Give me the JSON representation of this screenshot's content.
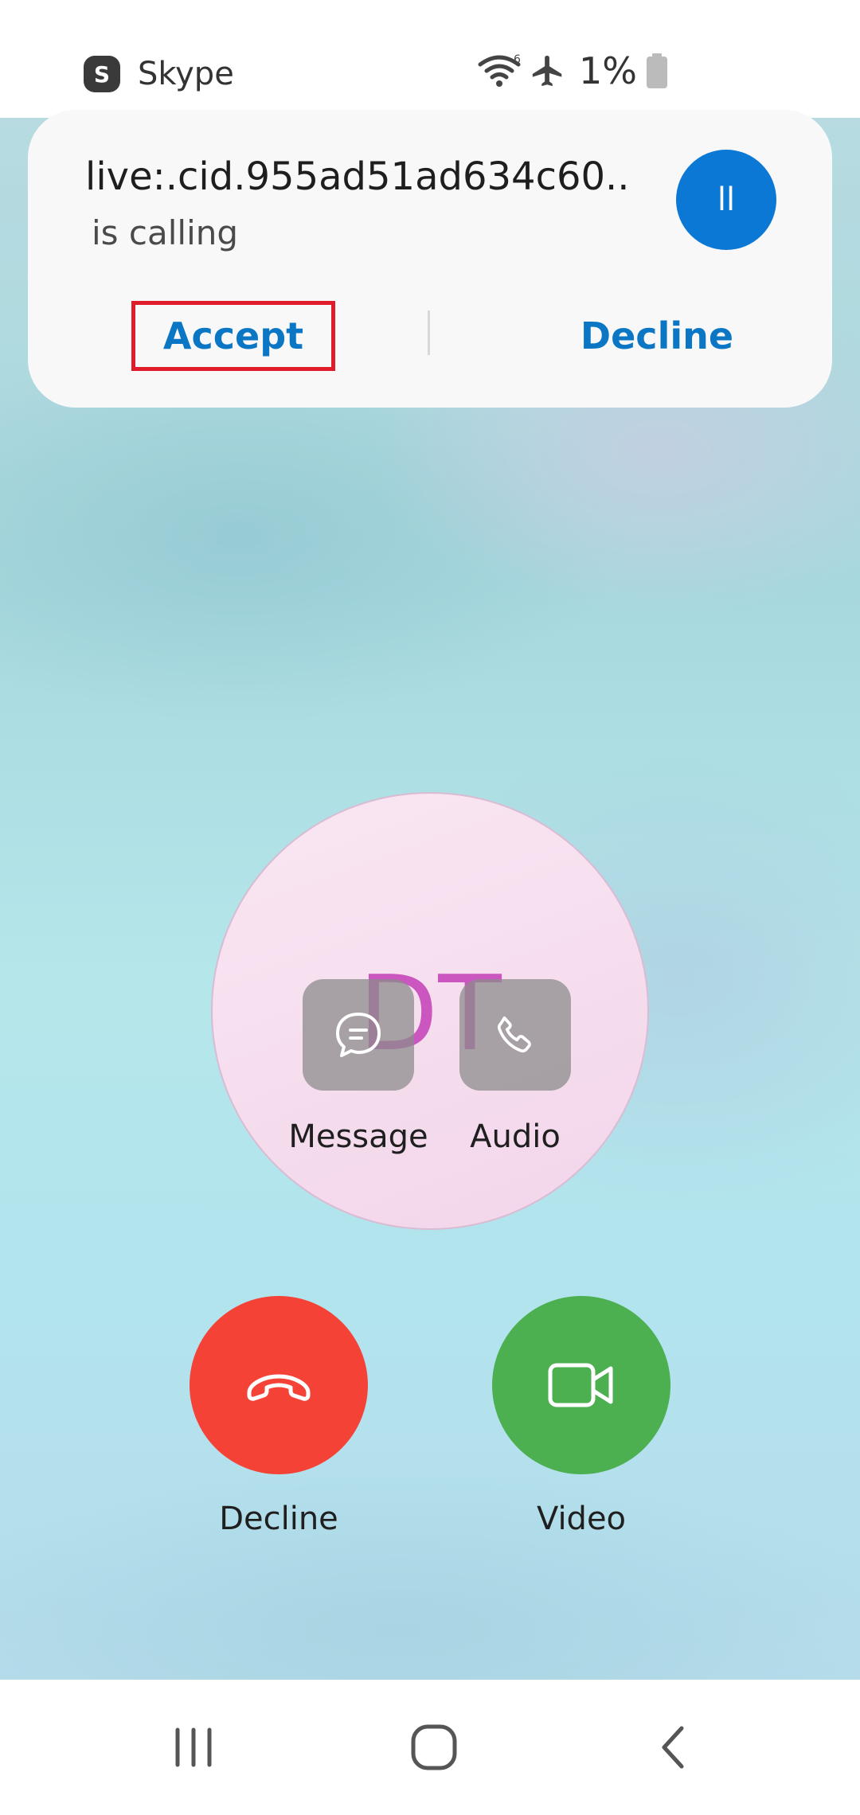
{
  "status_bar": {
    "app_name": "Skype",
    "app_logo_letter": "S",
    "battery": "1%",
    "icons": [
      "wifi-icon",
      "airplane-icon",
      "battery-icon"
    ]
  },
  "notification": {
    "caller_id": "live:.cid.955ad51ad634c60..",
    "status": "is calling",
    "avatar_initials": "ll",
    "avatar_color": "#0b78d6",
    "accept_label": "Accept",
    "decline_label": "Decline",
    "accent_color": "#0b77c4"
  },
  "caller": {
    "initials": "DT",
    "initials_color": "#c43fb7"
  },
  "quick_actions": {
    "message_label": "Message",
    "audio_label": "Audio"
  },
  "call_buttons": {
    "decline_label": "Decline",
    "decline_color": "#f44336",
    "video_label": "Video",
    "video_color": "#4caf50"
  },
  "nav": {
    "icons": [
      "recent-apps-icon",
      "home-icon",
      "back-icon"
    ]
  }
}
